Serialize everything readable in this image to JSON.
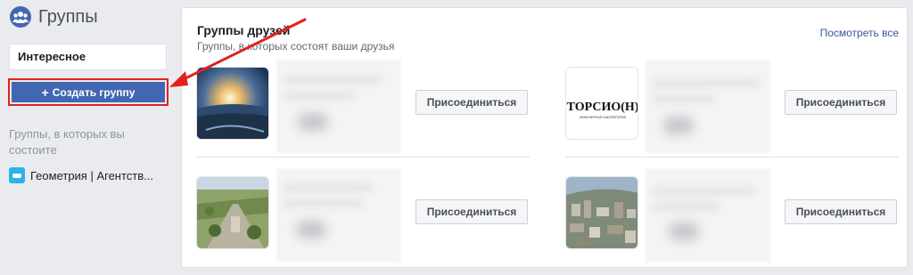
{
  "sidebar": {
    "title": "Группы",
    "tab_label": "Интересное",
    "create_button": "Создать группу",
    "create_plus": "+",
    "member_heading": "Группы, в которых вы состоите",
    "member_group": "Геометрия | Агентств..."
  },
  "card": {
    "title": "Группы друзей",
    "subtitle": "Группы, в которых состоят ваши друзья",
    "see_all": "Посмотреть все"
  },
  "groups": [
    {
      "join_label": "Присоединиться",
      "thumb": "landscape-sunset"
    },
    {
      "join_label": "Присоединиться",
      "thumb": "torsion-logo",
      "logo_text": "ТОРСИО(Н)",
      "logo_sub": "ИНЖЕНЕРНАЯ ЛАБОРАТОРИЯ"
    },
    {
      "join_label": "Присоединиться",
      "thumb": "park-aerial"
    },
    {
      "join_label": "Присоединиться",
      "thumb": "city-aerial"
    }
  ],
  "colors": {
    "accent": "#4267b2",
    "highlight": "#e1211f",
    "link": "#365899"
  }
}
